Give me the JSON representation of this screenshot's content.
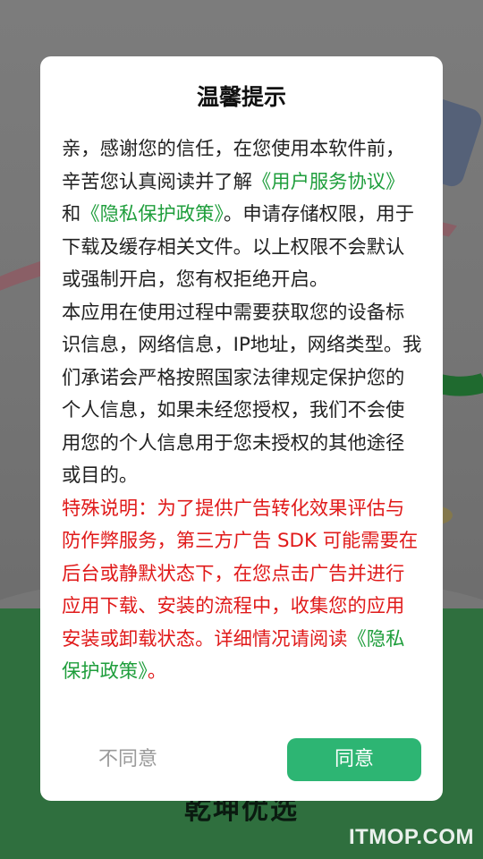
{
  "dialog": {
    "title": "温馨提示",
    "para1": {
      "text_a": "亲，感谢您的信任，在您使用本软件前，辛苦您认真阅读并了解",
      "link_user_agreement": "《用户服务协议》",
      "text_b": "和",
      "link_privacy_policy": "《隐私保护政策》",
      "text_c": "。申请存储权限，用于下载及缓存相关文件。以上权限不会默认或强制开启，您有权拒绝开启。"
    },
    "para2": "本应用在使用过程中需要获取您的设备标识信息，网络信息，IP地址，网络类型。我们承诺会严格按照国家法律规定保护您的个人信息，如果未经您授权，我们不会使用您的个人信息用于您未授权的其他途径或目的。",
    "special": {
      "text": "特殊说明：为了提供广告转化效果评估与防作弊服务，第三方广告 SDK 可能需要在后台或静默状态下，在您点击广告并进行应用下载、安装的流程中，收集您的应用安装或卸载状态。详细情况请阅读",
      "link_privacy_policy": "《隐私保护政策》",
      "end": "。"
    },
    "buttons": {
      "disagree": "不同意",
      "agree": "同意"
    }
  },
  "background": {
    "brand_text": "乾坤优选",
    "watermark": "ITMOP.COM"
  },
  "colors": {
    "link": "#1f9e3c",
    "special_text": "#e01a1a",
    "agree_button": "#2db573",
    "disagree_text": "#9a9a9a",
    "overlay": "#6f6f6f"
  }
}
